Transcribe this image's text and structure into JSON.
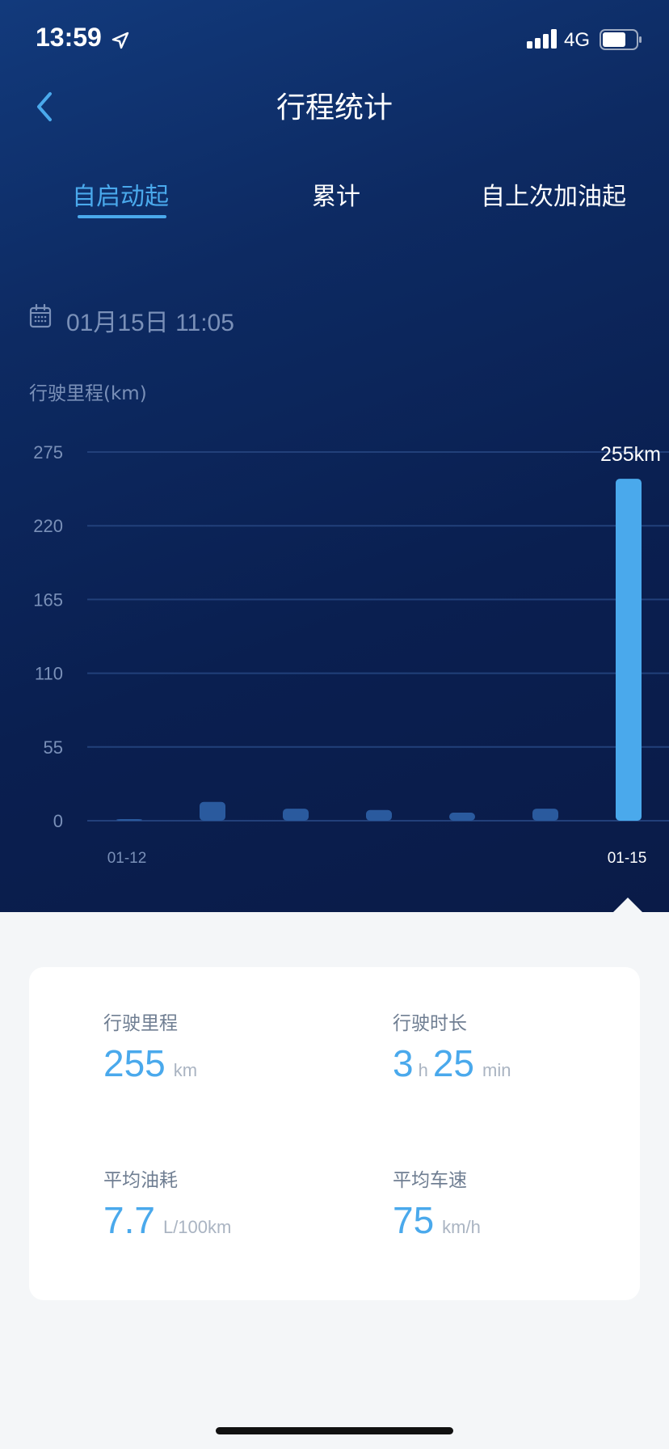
{
  "status_bar": {
    "time": "13:59",
    "network": "4G",
    "icons": [
      "location-arrow-icon",
      "signal-icon",
      "battery-icon"
    ]
  },
  "header": {
    "title": "行程统计",
    "back_icon": "chevron-left-icon"
  },
  "tabs": [
    {
      "label": "自启动起",
      "active": true
    },
    {
      "label": "累计",
      "active": false
    },
    {
      "label": "自上次加油起",
      "active": false
    }
  ],
  "date": {
    "icon": "calendar-icon",
    "text": "01月15日 11:05"
  },
  "chart_label": "行驶里程(km)",
  "chart_data": {
    "type": "bar",
    "title": "",
    "ylabel": "行驶里程(km)",
    "ylim": [
      0,
      275
    ],
    "yticks": [
      0,
      55,
      110,
      165,
      220,
      275
    ],
    "categories": [
      "01-12",
      "",
      "",
      "",
      "",
      "",
      "01-15"
    ],
    "values": [
      1,
      14,
      9,
      8,
      6,
      9,
      255
    ],
    "highlight_index": 6,
    "highlight_label": "255km",
    "grid": true,
    "colors": {
      "bar": "#2a5a9e",
      "highlight": "#4aa9ec",
      "grid": "#22407a",
      "tick": "#7a90b8"
    }
  },
  "stats": {
    "distance": {
      "label": "行驶里程",
      "value": "255",
      "unit": "km"
    },
    "duration": {
      "label": "行驶时长",
      "hours": "3",
      "hours_unit": "h",
      "minutes": "25",
      "minutes_unit": "min"
    },
    "fuel": {
      "label": "平均油耗",
      "value": "7.7",
      "unit": "L/100km"
    },
    "speed": {
      "label": "平均车速",
      "value": "75",
      "unit": "km/h"
    }
  },
  "colors": {
    "accent": "#4aa9ec",
    "background_top": "#0d2a62",
    "background_bottom": "#f4f6f8"
  }
}
